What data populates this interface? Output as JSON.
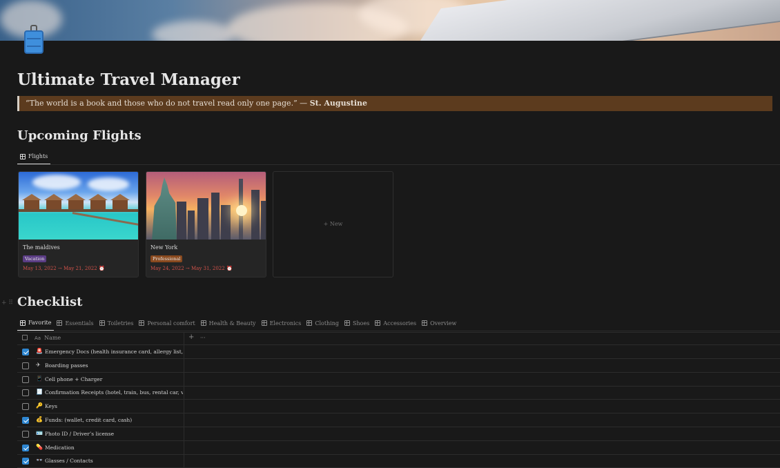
{
  "page": {
    "title": "Ultimate Travel Manager",
    "icon": "suitcase-icon",
    "quote_text": "“The world is a book and those who do not travel read only one page.” — ",
    "quote_author": "St. Augustine"
  },
  "flights_section": {
    "heading": "Upcoming Flights",
    "view_tab": "Flights",
    "cards": [
      {
        "name": "The maldives",
        "tag": "Vacation",
        "tag_color": "#5b3d85",
        "dates": "May 13, 2022 → May 21, 2022"
      },
      {
        "name": "New York",
        "tag": "Professional",
        "tag_color": "#8a4a1f",
        "dates": "May 24, 2022 → May 31, 2022"
      }
    ],
    "new_label": "+ New"
  },
  "checklist_section": {
    "heading": "Checklist",
    "tabs": [
      "Favorite",
      "Essentials",
      "Toiletries",
      "Personal comfort",
      "Health & Beauty",
      "Electronics",
      "Clothing",
      "Shoes",
      "Accessories",
      "Overview"
    ],
    "name_column": "Name",
    "name_column_icon": "Aa",
    "add_column": "+",
    "more": "···",
    "rows": [
      {
        "emoji": "🚨",
        "text": "Emergency Docs (health insurance card, allergy list, emergency contacts)",
        "checked": true
      },
      {
        "emoji": "✈",
        "text": "Boarding passes",
        "checked": false
      },
      {
        "emoji": "📱",
        "text": "Cell phone + Charger",
        "checked": false
      },
      {
        "emoji": "🧾",
        "text": "Confirmation Receipts (hotel, train, bus, rental car, venue)",
        "checked": false
      },
      {
        "emoji": "🔑",
        "text": "Keys",
        "checked": false
      },
      {
        "emoji": "💰",
        "text": "Funds: (wallet, credit card, cash)",
        "checked": true
      },
      {
        "emoji": "🪪",
        "text": "Photo ID / Driver’s license",
        "checked": false
      },
      {
        "emoji": "💊",
        "text": "Medication",
        "checked": true
      },
      {
        "emoji": "👓",
        "text": "Glasses / Contacts",
        "checked": true
      }
    ]
  },
  "colors": {
    "background": "#191919",
    "quote_bg": "#5c3b1e",
    "checkbox": "#2e86d1",
    "date_red": "#d2524a"
  }
}
